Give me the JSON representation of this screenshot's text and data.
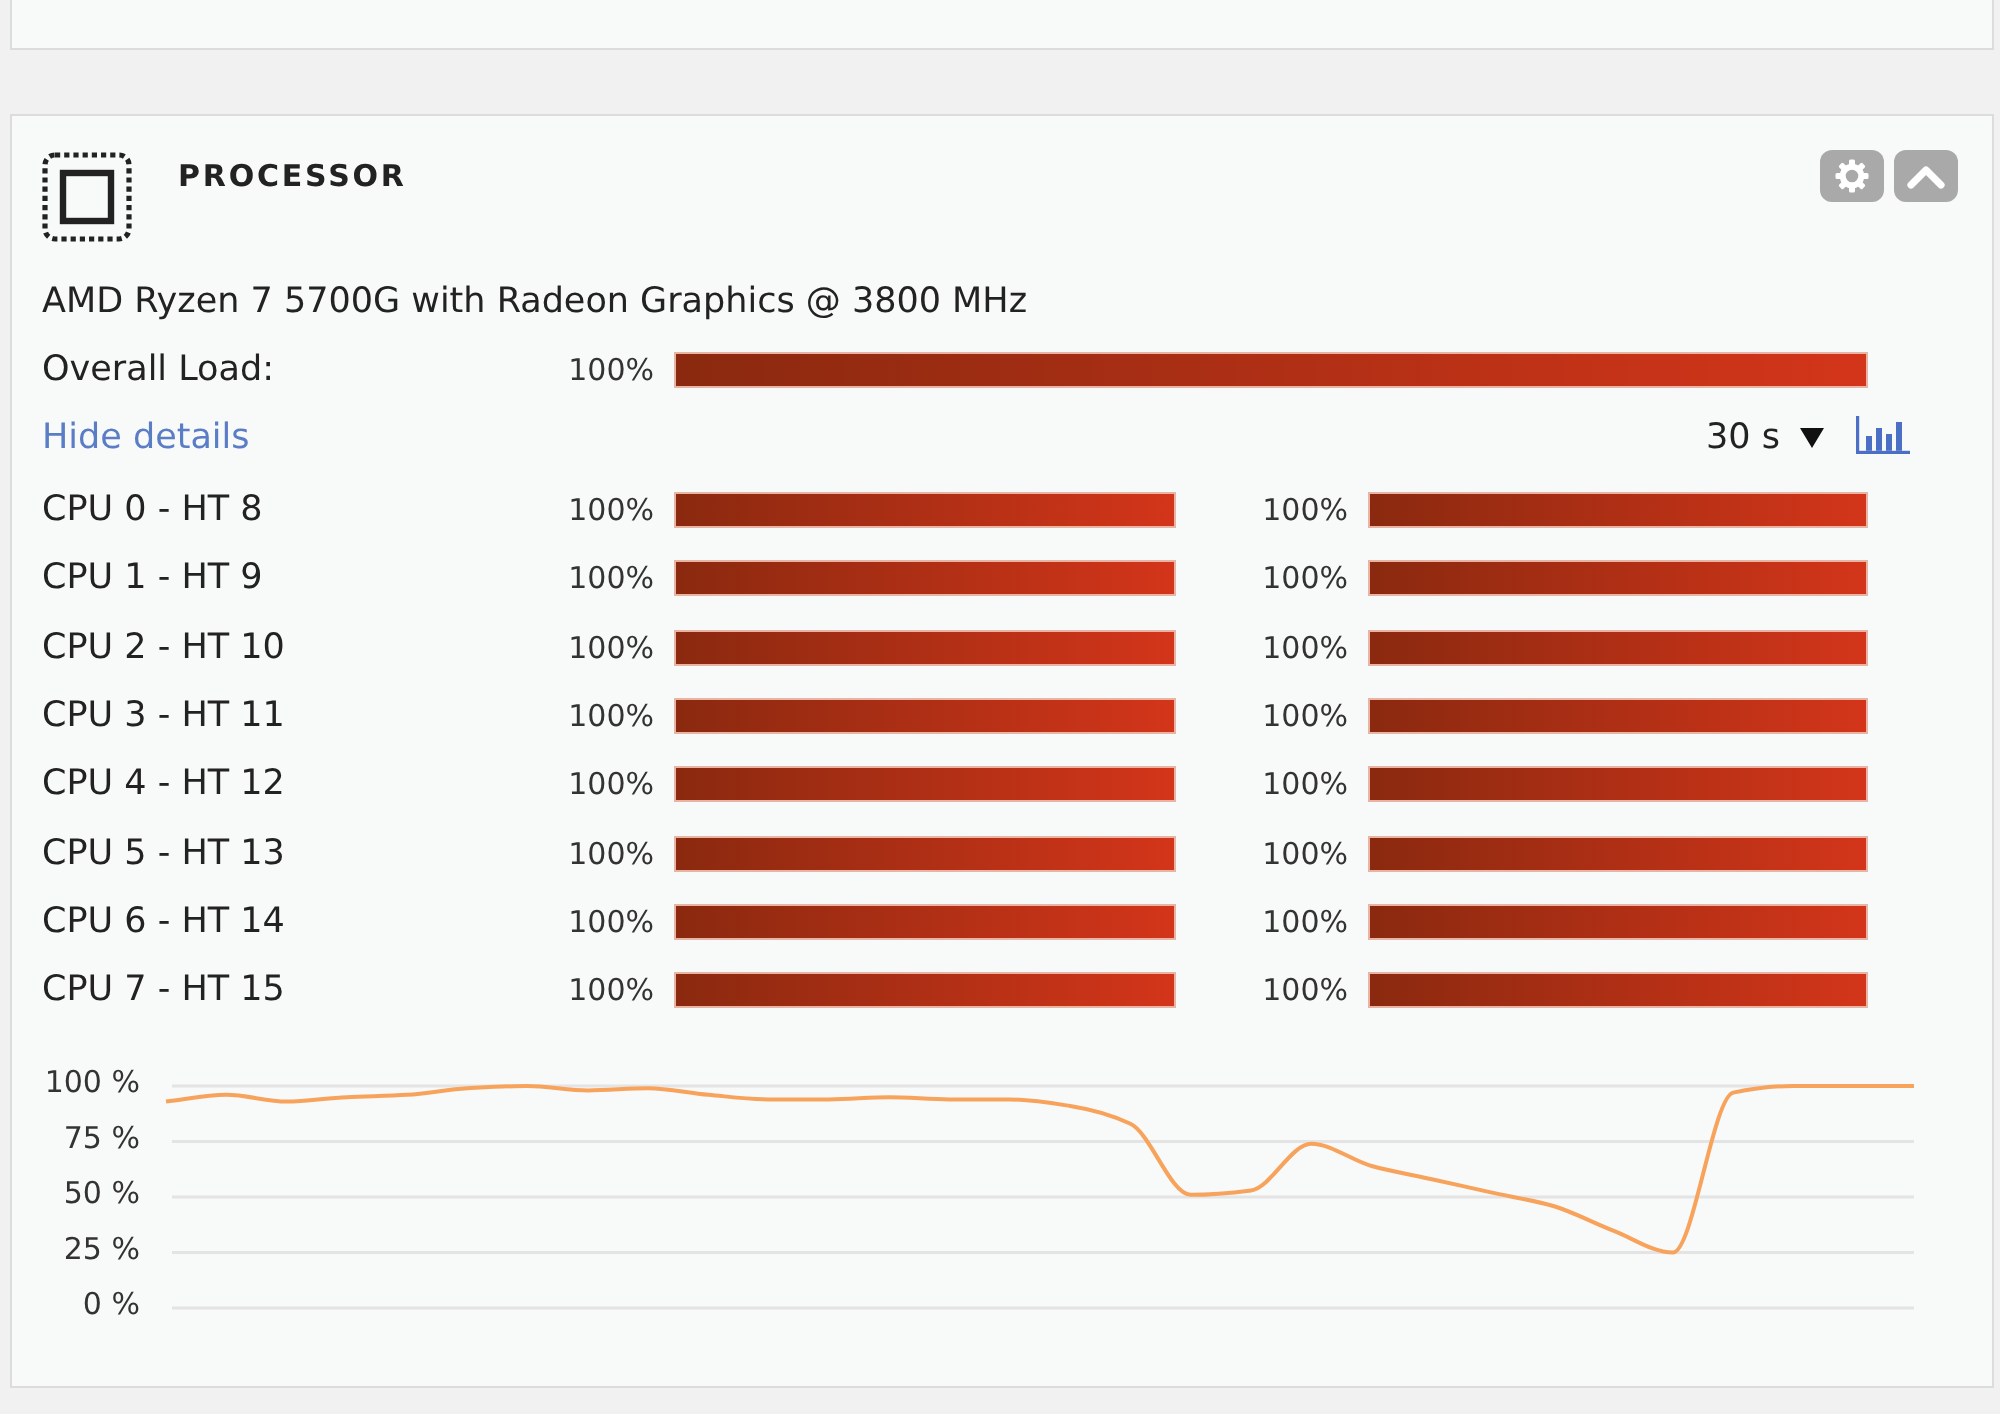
{
  "processor": {
    "title": "PROCESSOR",
    "model": "AMD Ryzen 7 5700G with Radeon Graphics @ 3800 MHz",
    "overall_load": {
      "label": "Overall Load:",
      "reading": "100%",
      "level": 1
    },
    "details_link": "Hide details",
    "interval": "30 s",
    "cores": [
      {
        "name": "CPU 0 - HT 8",
        "threads": [
          {
            "reading": "100%",
            "level": 1
          },
          {
            "reading": "100%",
            "level": 1
          }
        ]
      },
      {
        "name": "CPU 1 - HT 9",
        "threads": [
          {
            "reading": "100%",
            "level": 1
          },
          {
            "reading": "100%",
            "level": 1
          }
        ]
      },
      {
        "name": "CPU 2 - HT 10",
        "threads": [
          {
            "reading": "100%",
            "level": 1
          },
          {
            "reading": "100%",
            "level": 1
          }
        ]
      },
      {
        "name": "CPU 3 - HT 11",
        "threads": [
          {
            "reading": "100%",
            "level": 1
          },
          {
            "reading": "100%",
            "level": 1
          }
        ]
      },
      {
        "name": "CPU 4 - HT 12",
        "threads": [
          {
            "reading": "100%",
            "level": 1
          },
          {
            "reading": "100%",
            "level": 1
          }
        ]
      },
      {
        "name": "CPU 5 - HT 13",
        "threads": [
          {
            "reading": "100%",
            "level": 1
          },
          {
            "reading": "100%",
            "level": 1
          }
        ]
      },
      {
        "name": "CPU 6 - HT 14",
        "threads": [
          {
            "reading": "100%",
            "level": 1
          },
          {
            "reading": "100%",
            "level": 1
          }
        ]
      },
      {
        "name": "CPU 7 - HT 15",
        "threads": [
          {
            "reading": "100%",
            "level": 1
          },
          {
            "reading": "100%",
            "level": 1
          }
        ]
      }
    ],
    "chart_data": {
      "type": "line",
      "categories": [
        null,
        null,
        null,
        null,
        null,
        null,
        null,
        null,
        null,
        null,
        null,
        null,
        null,
        null,
        null,
        null,
        null,
        null,
        null,
        null,
        null,
        null,
        null,
        null,
        null,
        null,
        null,
        null,
        null,
        null
      ],
      "values": [
        93,
        96,
        93,
        95,
        96,
        99,
        100,
        98,
        99,
        96,
        94,
        94,
        95,
        94,
        94,
        91,
        83,
        51,
        53,
        74,
        64,
        58,
        52,
        46,
        35,
        25,
        97,
        100,
        100,
        100
      ],
      "color": "#f7a35c",
      "ylim": [
        0,
        100
      ],
      "yticks": [
        {
          "value": 100,
          "label": "100 %"
        },
        {
          "value": 75,
          "label": "75 %"
        },
        {
          "value": 50,
          "label": "50 %"
        },
        {
          "value": 25,
          "label": "25 %"
        },
        {
          "value": 0,
          "label": "0 %"
        }
      ],
      "grid": true,
      "tick_labels": "y"
    }
  }
}
